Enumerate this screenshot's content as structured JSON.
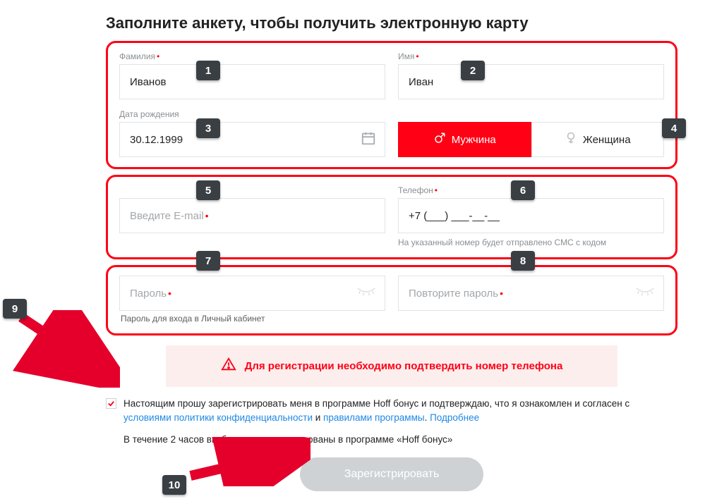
{
  "title": "Заполните анкету, чтобы получить электронную карту",
  "group1": {
    "lastname_label": "Фамилия",
    "lastname_value": "Иванов",
    "firstname_label": "Имя",
    "firstname_value": "Иван",
    "dob_label": "Дата рождения",
    "dob_value": "30.12.1999",
    "gender_male": "Мужчина",
    "gender_female": "Женщина"
  },
  "group2": {
    "email_placeholder": "Введите E-mail",
    "phone_label": "Телефон",
    "phone_value": "+7 (___) ___-__-__",
    "phone_hint": "На указанный номер будет отправлено СМС с кодом"
  },
  "group3": {
    "password_placeholder": "Пароль",
    "password2_placeholder": "Повторите пароль",
    "password_hint": "Пароль для входа в Личный кабинет"
  },
  "alert": "Для регистрации необходимо подтвердить номер телефона",
  "consent": {
    "text_before": "Настоящим прошу зарегистрировать меня в программе Hoff бонус и подтверждаю, что я ознакомлен и согласен с ",
    "link1": "условиями политики конфиденциальности",
    "between": " и ",
    "link2": "правилами программы",
    "period": ". ",
    "more": "Подробнее"
  },
  "wait_note": "В течение 2 часов вы будете зарегистрированы в программе «Hoff бонус»",
  "submit": "Зарегистрировать",
  "markers": {
    "m1": "1",
    "m2": "2",
    "m3": "3",
    "m4": "4",
    "m5": "5",
    "m6": "6",
    "m7": "7",
    "m8": "8",
    "m9": "9",
    "m10": "10"
  }
}
